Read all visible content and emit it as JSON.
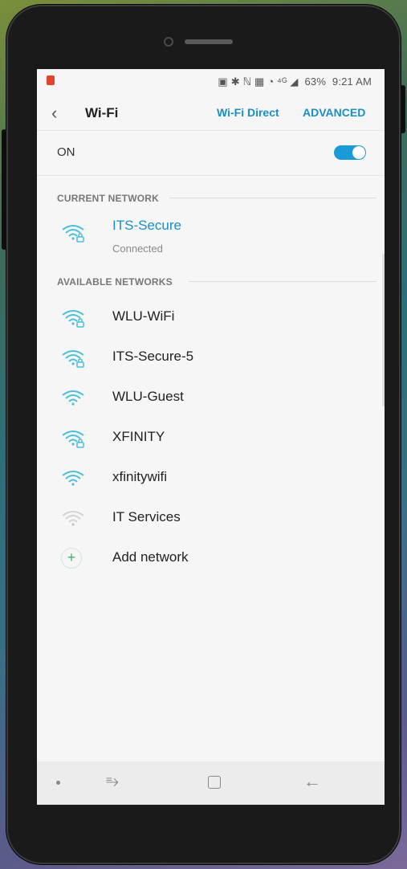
{
  "status_bar": {
    "icons_text": "▣ ✱ ℕ ▦ ◔ ⁴ᴳ ◢",
    "battery": "63%",
    "time": "9:21 AM"
  },
  "appbar": {
    "back_glyph": "‹",
    "title": "Wi-Fi",
    "wifi_direct": "Wi-Fi Direct",
    "advanced": "ADVANCED"
  },
  "toggle_row": {
    "label": "ON",
    "state": "on"
  },
  "current_section": "CURRENT NETWORK",
  "current_network": {
    "name": "ITS-Secure",
    "status": "Connected",
    "secured": true
  },
  "available_section": "AVAILABLE NETWORKS",
  "networks": [
    {
      "name": "WLU-WiFi",
      "secured": true
    },
    {
      "name": "ITS-Secure-5",
      "secured": true
    },
    {
      "name": "WLU-Guest",
      "secured": false
    },
    {
      "name": "XFINITY",
      "secured": true
    },
    {
      "name": "xfinitywifi",
      "secured": false
    },
    {
      "name": "IT Services",
      "secured": false,
      "weak": true
    }
  ],
  "add_network": {
    "icon": "+",
    "label": "Add network"
  },
  "nav": {
    "recent_glyph": "⥱",
    "back_glyph": "←"
  },
  "colors": {
    "accent": "#1a8fc4",
    "toggle": "#1a9ad6",
    "wifi_icon": "#4bbfd9",
    "add_icon": "#3fb36b"
  }
}
